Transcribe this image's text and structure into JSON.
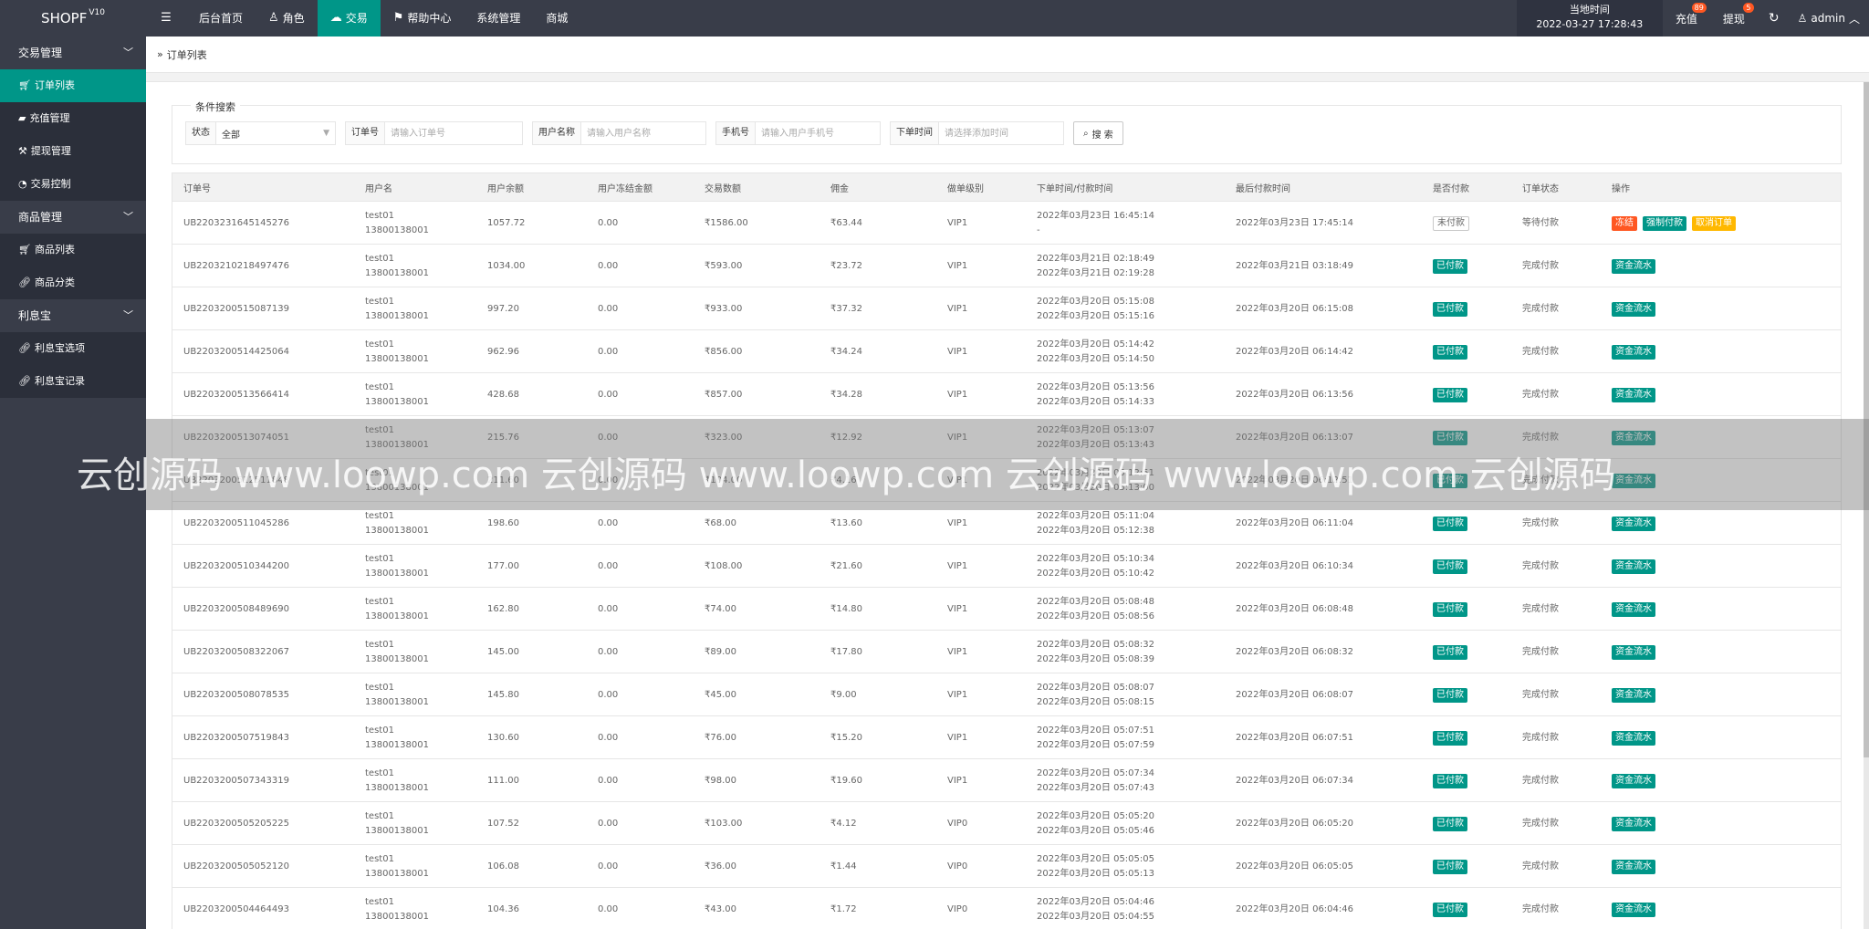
{
  "app": {
    "logo": "SHOPF",
    "version": "V10"
  },
  "topnav": {
    "items": [
      {
        "label": "后台首页",
        "icon": ""
      },
      {
        "label": "角色",
        "icon": "user-icon"
      },
      {
        "label": "交易",
        "icon": "cloud-icon"
      },
      {
        "label": "帮助中心",
        "icon": "flag-icon"
      },
      {
        "label": "系统管理",
        "icon": ""
      },
      {
        "label": "商城",
        "icon": ""
      }
    ],
    "time_label": "当地时间",
    "time_value": "2022-03-27 17:28:43",
    "recharge_label": "充值",
    "recharge_badge": "89",
    "withdraw_label": "提现",
    "withdraw_badge": "5",
    "user_label": "admin"
  },
  "sidebar": {
    "groups": [
      {
        "label": "交易管理",
        "items": [
          "订单列表",
          "充值管理",
          "提现管理",
          "交易控制"
        ]
      },
      {
        "label": "商品管理",
        "items": [
          "商品列表",
          "商品分类"
        ]
      },
      {
        "label": "利息宝",
        "items": [
          "利息宝选项",
          "利息宝记录"
        ]
      }
    ]
  },
  "breadcrumb": {
    "current": "订单列表"
  },
  "search": {
    "legend": "条件搜索",
    "status_label": "状态",
    "status_value": "全部",
    "order_label": "订单号",
    "order_placeholder": "请输入订单号",
    "user_label": "用户名称",
    "user_placeholder": "请输入用户名称",
    "phone_label": "手机号",
    "phone_placeholder": "请输入用户手机号",
    "time_label": "下单时间",
    "time_placeholder": "请选择添加时间",
    "button": "搜 索"
  },
  "table": {
    "headers": [
      "订单号",
      "用户名",
      "用户余额",
      "用户冻结金额",
      "交易数额",
      "佣金",
      "做单级别",
      "下单时间/付款时间",
      "最后付款时间",
      "是否付款",
      "订单状态",
      "操作"
    ],
    "rows": [
      {
        "order": "UB2203231645145276",
        "user": "test01",
        "phone": "13800138001",
        "balance": "1057.72",
        "frozen": "0.00",
        "amount": "₹1586.00",
        "commission": "₹63.44",
        "level": "VIP1",
        "time1": "2022年03月23日 16:45:14",
        "time2": "-",
        "last": "2022年03月23日 17:45:14",
        "paid": "未付款",
        "status": "等待付款",
        "actions": [
          "冻结",
          "强制付款",
          "取消订单"
        ]
      },
      {
        "order": "UB2203210218497476",
        "user": "test01",
        "phone": "13800138001",
        "balance": "1034.00",
        "frozen": "0.00",
        "amount": "₹593.00",
        "commission": "₹23.72",
        "level": "VIP1",
        "time1": "2022年03月21日 02:18:49",
        "time2": "2022年03月21日 02:19:28",
        "last": "2022年03月21日 03:18:49",
        "paid": "已付款",
        "status": "完成付款",
        "actions": [
          "资金流水"
        ]
      },
      {
        "order": "UB2203200515087139",
        "user": "test01",
        "phone": "13800138001",
        "balance": "997.20",
        "frozen": "0.00",
        "amount": "₹933.00",
        "commission": "₹37.32",
        "level": "VIP1",
        "time1": "2022年03月20日 05:15:08",
        "time2": "2022年03月20日 05:15:16",
        "last": "2022年03月20日 06:15:08",
        "paid": "已付款",
        "status": "完成付款",
        "actions": [
          "资金流水"
        ]
      },
      {
        "order": "UB2203200514425064",
        "user": "test01",
        "phone": "13800138001",
        "balance": "962.96",
        "frozen": "0.00",
        "amount": "₹856.00",
        "commission": "₹34.24",
        "level": "VIP1",
        "time1": "2022年03月20日 05:14:42",
        "time2": "2022年03月20日 05:14:50",
        "last": "2022年03月20日 06:14:42",
        "paid": "已付款",
        "status": "完成付款",
        "actions": [
          "资金流水"
        ]
      },
      {
        "order": "UB2203200513566414",
        "user": "test01",
        "phone": "13800138001",
        "balance": "428.68",
        "frozen": "0.00",
        "amount": "₹857.00",
        "commission": "₹34.28",
        "level": "VIP1",
        "time1": "2022年03月20日 05:13:56",
        "time2": "2022年03月20日 05:14:33",
        "last": "2022年03月20日 06:13:56",
        "paid": "已付款",
        "status": "完成付款",
        "actions": [
          "资金流水"
        ]
      },
      {
        "order": "UB2203200513074051",
        "user": "test01",
        "phone": "13800138001",
        "balance": "215.76",
        "frozen": "0.00",
        "amount": "₹323.00",
        "commission": "₹12.92",
        "level": "VIP1",
        "time1": "2022年03月20日 05:13:07",
        "time2": "2022年03月20日 05:13:43",
        "last": "2022年03月20日 06:13:07",
        "paid": "已付款",
        "status": "完成付款",
        "actions": [
          "资金流水"
        ]
      },
      {
        "order": "UB2203200512511848",
        "user": "test01",
        "phone": "13800138001",
        "balance": "211.60",
        "frozen": "0.00",
        "amount": "₹104.00",
        "commission": "₹4.16",
        "level": "VIP1",
        "time1": "2022年03月20日 05:12:51",
        "time2": "2022年03月20日 05:13:00",
        "last": "2022年03月20日 06:12:51",
        "paid": "已付款",
        "status": "完成付款",
        "actions": [
          "资金流水"
        ]
      },
      {
        "order": "UB2203200511045286",
        "user": "test01",
        "phone": "13800138001",
        "balance": "198.60",
        "frozen": "0.00",
        "amount": "₹68.00",
        "commission": "₹13.60",
        "level": "VIP1",
        "time1": "2022年03月20日 05:11:04",
        "time2": "2022年03月20日 05:12:38",
        "last": "2022年03月20日 06:11:04",
        "paid": "已付款",
        "status": "完成付款",
        "actions": [
          "资金流水"
        ]
      },
      {
        "order": "UB2203200510344200",
        "user": "test01",
        "phone": "13800138001",
        "balance": "177.00",
        "frozen": "0.00",
        "amount": "₹108.00",
        "commission": "₹21.60",
        "level": "VIP1",
        "time1": "2022年03月20日 05:10:34",
        "time2": "2022年03月20日 05:10:42",
        "last": "2022年03月20日 06:10:34",
        "paid": "已付款",
        "status": "完成付款",
        "actions": [
          "资金流水"
        ]
      },
      {
        "order": "UB2203200508489690",
        "user": "test01",
        "phone": "13800138001",
        "balance": "162.80",
        "frozen": "0.00",
        "amount": "₹74.00",
        "commission": "₹14.80",
        "level": "VIP1",
        "time1": "2022年03月20日 05:08:48",
        "time2": "2022年03月20日 05:08:56",
        "last": "2022年03月20日 06:08:48",
        "paid": "已付款",
        "status": "完成付款",
        "actions": [
          "资金流水"
        ]
      },
      {
        "order": "UB2203200508322067",
        "user": "test01",
        "phone": "13800138001",
        "balance": "145.00",
        "frozen": "0.00",
        "amount": "₹89.00",
        "commission": "₹17.80",
        "level": "VIP1",
        "time1": "2022年03月20日 05:08:32",
        "time2": "2022年03月20日 05:08:39",
        "last": "2022年03月20日 06:08:32",
        "paid": "已付款",
        "status": "完成付款",
        "actions": [
          "资金流水"
        ]
      },
      {
        "order": "UB2203200508078535",
        "user": "test01",
        "phone": "13800138001",
        "balance": "145.80",
        "frozen": "0.00",
        "amount": "₹45.00",
        "commission": "₹9.00",
        "level": "VIP1",
        "time1": "2022年03月20日 05:08:07",
        "time2": "2022年03月20日 05:08:15",
        "last": "2022年03月20日 06:08:07",
        "paid": "已付款",
        "status": "完成付款",
        "actions": [
          "资金流水"
        ]
      },
      {
        "order": "UB2203200507519843",
        "user": "test01",
        "phone": "13800138001",
        "balance": "130.60",
        "frozen": "0.00",
        "amount": "₹76.00",
        "commission": "₹15.20",
        "level": "VIP1",
        "time1": "2022年03月20日 05:07:51",
        "time2": "2022年03月20日 05:07:59",
        "last": "2022年03月20日 06:07:51",
        "paid": "已付款",
        "status": "完成付款",
        "actions": [
          "资金流水"
        ]
      },
      {
        "order": "UB2203200507343319",
        "user": "test01",
        "phone": "13800138001",
        "balance": "111.00",
        "frozen": "0.00",
        "amount": "₹98.00",
        "commission": "₹19.60",
        "level": "VIP1",
        "time1": "2022年03月20日 05:07:34",
        "time2": "2022年03月20日 05:07:43",
        "last": "2022年03月20日 06:07:34",
        "paid": "已付款",
        "status": "完成付款",
        "actions": [
          "资金流水"
        ]
      },
      {
        "order": "UB2203200505205225",
        "user": "test01",
        "phone": "13800138001",
        "balance": "107.52",
        "frozen": "0.00",
        "amount": "₹103.00",
        "commission": "₹4.12",
        "level": "VIP0",
        "time1": "2022年03月20日 05:05:20",
        "time2": "2022年03月20日 05:05:46",
        "last": "2022年03月20日 06:05:20",
        "paid": "已付款",
        "status": "完成付款",
        "actions": [
          "资金流水"
        ]
      },
      {
        "order": "UB2203200505052120",
        "user": "test01",
        "phone": "13800138001",
        "balance": "106.08",
        "frozen": "0.00",
        "amount": "₹36.00",
        "commission": "₹1.44",
        "level": "VIP0",
        "time1": "2022年03月20日 05:05:05",
        "time2": "2022年03月20日 05:05:13",
        "last": "2022年03月20日 06:05:05",
        "paid": "已付款",
        "status": "完成付款",
        "actions": [
          "资金流水"
        ]
      },
      {
        "order": "UB2203200504464493",
        "user": "test01",
        "phone": "13800138001",
        "balance": "104.36",
        "frozen": "0.00",
        "amount": "₹43.00",
        "commission": "₹1.72",
        "level": "VIP0",
        "time1": "2022年03月20日 05:04:46",
        "time2": "2022年03月20日 05:04:55",
        "last": "2022年03月20日 06:04:46",
        "paid": "已付款",
        "status": "完成付款",
        "actions": [
          "资金流水"
        ]
      }
    ]
  },
  "watermark": "云创源码 www.loowp.com 云创源码 www.loowp.com 云创源码 www.loowp.com 云创源码",
  "colors": {
    "accent": "#009688",
    "sidebar_bg": "#393d49",
    "danger": "#ff5722",
    "warning": "#ffb800"
  }
}
